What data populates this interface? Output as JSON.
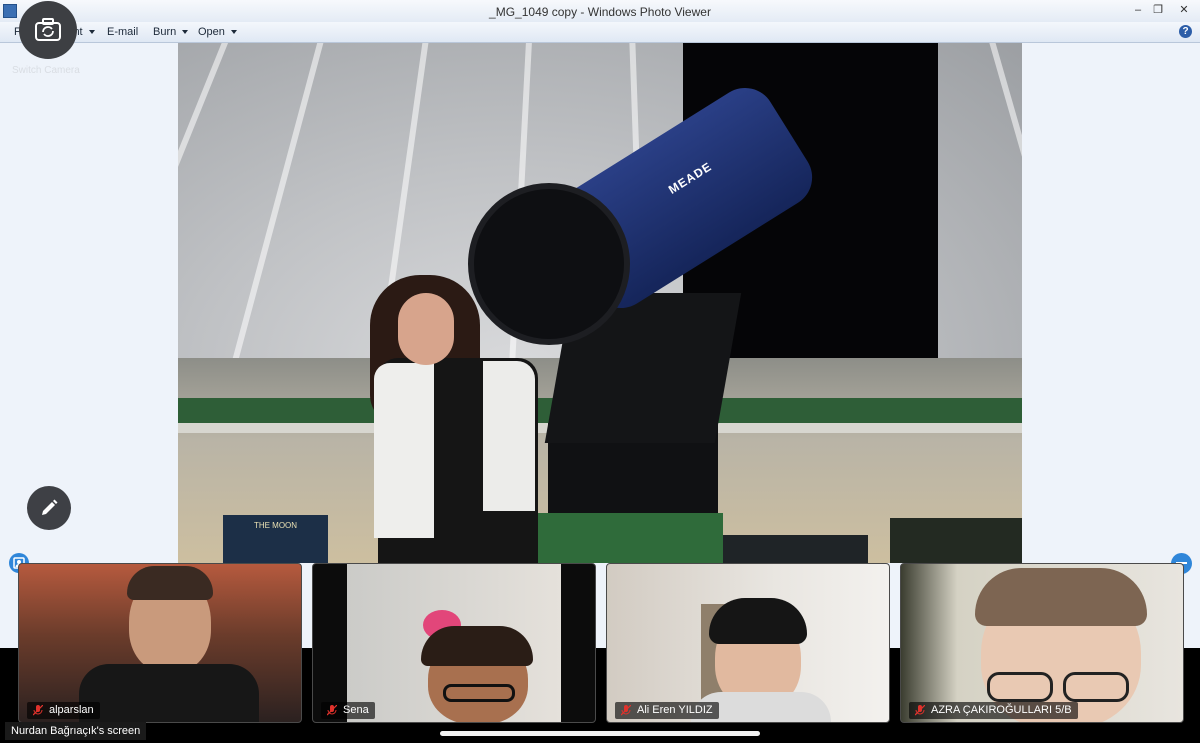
{
  "photo_viewer": {
    "window_title": "_MG_1049 copy - Windows Photo Viewer",
    "menu": {
      "file": "File",
      "print": "Print",
      "email": "E-mail",
      "burn": "Burn",
      "open": "Open"
    },
    "window_buttons": {
      "minimize": "–",
      "restore": "❐",
      "close": "✕"
    },
    "help": "?"
  },
  "photo": {
    "telescope_brand": "MEADE",
    "poster_text": "THE MOON"
  },
  "controls": {
    "switch_camera_label": "Switch Camera"
  },
  "participants": [
    {
      "name": "alparslan",
      "muted": true
    },
    {
      "name": "Sena",
      "muted": true
    },
    {
      "name": "Ali Eren YILDIZ",
      "muted": true
    },
    {
      "name": "AZRA ÇAKIROĞULLARI 5/B",
      "muted": true
    }
  ],
  "screen_share_label": "Nurdan Bağrıaçık's screen",
  "colors": {
    "accent": "#2f86d9",
    "muted_mic": "#e0322c"
  }
}
